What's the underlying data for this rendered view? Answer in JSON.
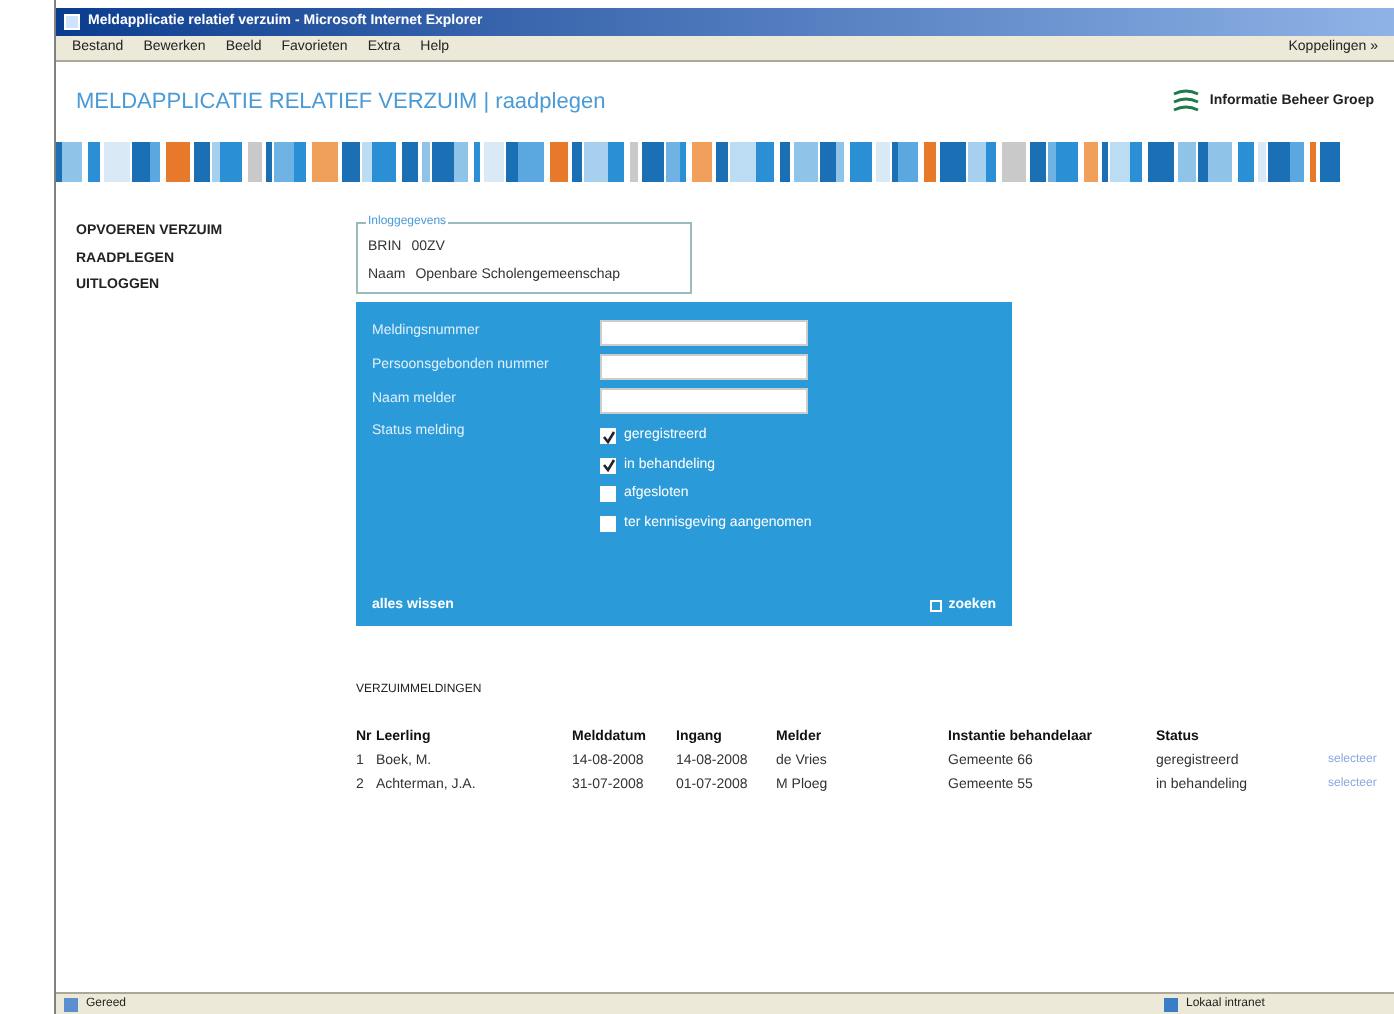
{
  "window": {
    "title": "Meldapplicatie relatief verzuim - Microsoft Internet Explorer"
  },
  "menu": [
    "Bestand",
    "Bewerken",
    "Beeld",
    "Favorieten",
    "Extra",
    "Help"
  ],
  "links_label": "Koppelingen »",
  "header": {
    "title": "MELDAPPLICATIE RELATIEF VERZUIM | raadplegen",
    "logo_text": "Informatie Beheer Groep"
  },
  "sidebar": {
    "items": [
      {
        "label": "OPVOEREN VERZUIM"
      },
      {
        "label": "RAADPLEGEN"
      },
      {
        "label": "UITLOGGEN"
      }
    ]
  },
  "login": {
    "legend": "Inloggegevens",
    "rows": [
      {
        "label": "BRIN",
        "value": "00ZV"
      },
      {
        "label": "Naam",
        "value": "Openbare Scholengemeenschap"
      }
    ]
  },
  "search_form": {
    "fields": [
      {
        "label": "Meldingsnummer"
      },
      {
        "label": "Persoonsgebonden nummer"
      },
      {
        "label": "Naam melder"
      }
    ],
    "status_label": "Status melding",
    "statuses": [
      {
        "label": "geregistreerd",
        "checked": true
      },
      {
        "label": "in behandeling",
        "checked": true
      },
      {
        "label": "afgesloten",
        "checked": false
      },
      {
        "label": "ter kennisgeving aangenomen",
        "checked": false
      }
    ],
    "clear_link": "alles wissen",
    "search_button": "zoeken"
  },
  "results": {
    "title": "VERZUIMMELDINGEN",
    "columns": [
      "Nr",
      "Leerling",
      "Melddatum",
      "Ingang",
      "Melder",
      "Instantie behandelaar",
      "Status"
    ],
    "rows": [
      {
        "cells": [
          "1",
          "Boek, M.",
          "14-08-2008",
          "14-08-2008",
          "de Vries",
          "Gemeente 66",
          "geregistreerd"
        ],
        "action": "selecteer"
      },
      {
        "cells": [
          "2",
          "Achterman, J.A.",
          "31-07-2008",
          "01-07-2008",
          "M Ploeg",
          "Gemeente 55",
          "in behandeling"
        ],
        "action": "selecteer"
      }
    ]
  },
  "status_bar": {
    "left": "Gereed",
    "zone": "Lokaal intranet"
  }
}
